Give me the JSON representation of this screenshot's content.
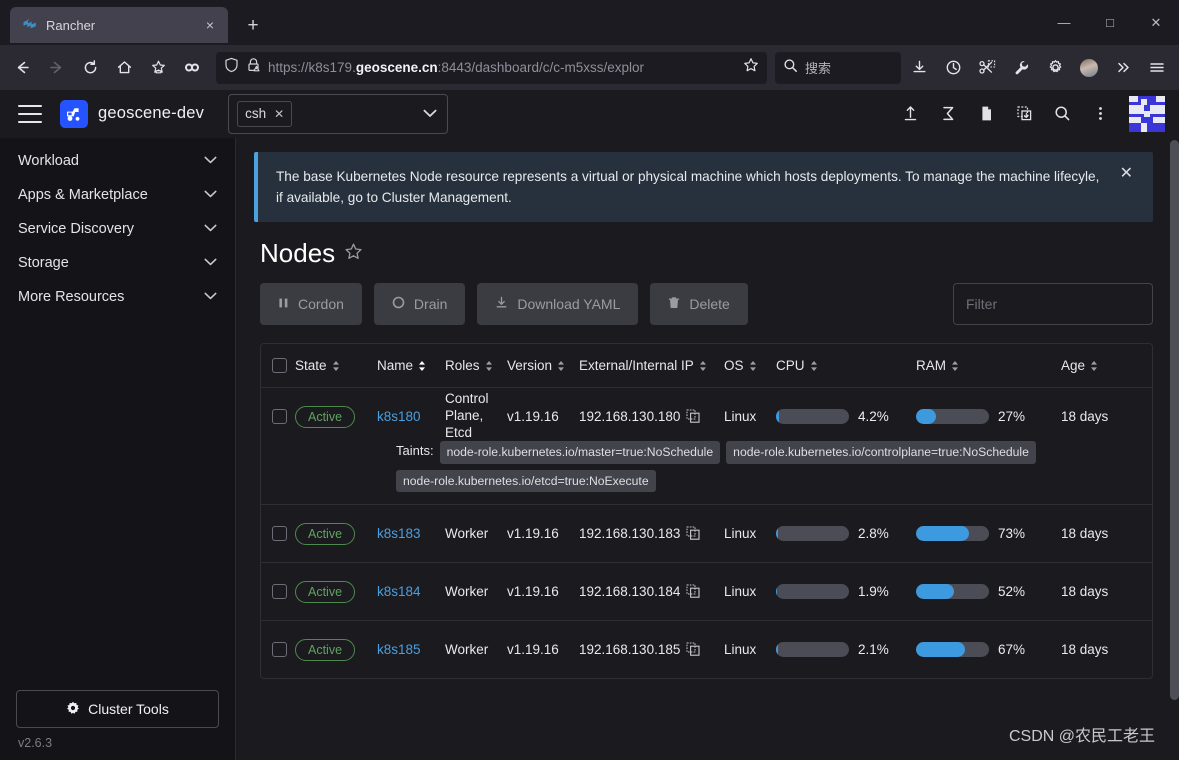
{
  "browser": {
    "tab": {
      "title": "Rancher",
      "favicon": "rancher-favicon",
      "close": "×"
    },
    "newtab_label": "+",
    "window_controls": {
      "minimize": "—",
      "maximize": "□",
      "close": "✕"
    },
    "nav": {
      "back": "←",
      "forward": "→",
      "reload": "↻",
      "home": "⌂",
      "bookmarks": "☆",
      "pocket": "∞"
    },
    "url": {
      "scheme": "https://",
      "host_pre": "k8s179.",
      "host_bold": "geoscene.cn",
      "rest": ":8443/dashboard/c/c-m5xss/explor",
      "full": "https://k8s179.geoscene.cn:8443/dashboard/c/c-m5xss/explor"
    },
    "url_bookmark": "☆",
    "search": {
      "placeholder": "搜索",
      "icon": "search-icon"
    },
    "toolbar_icons": [
      "download-icon",
      "history-icon",
      "screenshot-icon",
      "wrench-icon",
      "settings-gear-icon",
      "profile-avatar-icon",
      "overflow-chevrons-icon",
      "app-menu-icon"
    ]
  },
  "header": {
    "menu_icon": "hamburger-icon",
    "brand": "geoscene-dev",
    "namespace_select": {
      "chip": "csh",
      "chip_close": "✕",
      "caret": "⌄"
    },
    "actions": [
      "import-yaml-icon",
      "kubectl-shell-icon",
      "docs-icon",
      "download-kubeconfig-icon",
      "search-icon",
      "kebab-icon"
    ]
  },
  "sidebar": {
    "items": [
      {
        "label": "Workload"
      },
      {
        "label": "Apps & Marketplace"
      },
      {
        "label": "Service Discovery"
      },
      {
        "label": "Storage"
      },
      {
        "label": "More Resources"
      }
    ],
    "cluster_tools": "Cluster Tools",
    "version": "v2.6.3"
  },
  "banner": {
    "text": "The base Kubernetes Node resource represents a virtual or physical machine which hosts deployments. To manage the machine lifecyle, if available, go to Cluster Management.",
    "close": "✕"
  },
  "page": {
    "title": "Nodes",
    "favorite_icon": "☆"
  },
  "toolbar": {
    "cordon": "Cordon",
    "drain": "Drain",
    "download_yaml": "Download YAML",
    "delete": "Delete",
    "filter_placeholder": "Filter"
  },
  "table": {
    "columns": [
      "State",
      "Name",
      "Roles",
      "Version",
      "External/Internal IP",
      "OS",
      "CPU",
      "RAM",
      "Age"
    ],
    "rows": [
      {
        "state": "Active",
        "name": "k8s180",
        "roles": "Control Plane, Etcd",
        "version": "v1.19.16",
        "ip": "192.168.130.180",
        "os": "Linux",
        "cpu_pct": "4.2%",
        "cpu_value": 4.2,
        "ram_pct": "27%",
        "ram_value": 27,
        "age": "18 days",
        "taints_label": "Taints:",
        "taints": [
          "node-role.kubernetes.io/master=true:NoSchedule",
          "node-role.kubernetes.io/controlplane=true:NoSchedule",
          "node-role.kubernetes.io/etcd=true:NoExecute"
        ]
      },
      {
        "state": "Active",
        "name": "k8s183",
        "roles": "Worker",
        "version": "v1.19.16",
        "ip": "192.168.130.183",
        "os": "Linux",
        "cpu_pct": "2.8%",
        "cpu_value": 2.8,
        "ram_pct": "73%",
        "ram_value": 73,
        "age": "18 days",
        "taints": []
      },
      {
        "state": "Active",
        "name": "k8s184",
        "roles": "Worker",
        "version": "v1.19.16",
        "ip": "192.168.130.184",
        "os": "Linux",
        "cpu_pct": "1.9%",
        "cpu_value": 1.9,
        "ram_pct": "52%",
        "ram_value": 52,
        "age": "18 days",
        "taints": []
      },
      {
        "state": "Active",
        "name": "k8s185",
        "roles": "Worker",
        "version": "v1.19.16",
        "ip": "192.168.130.185",
        "os": "Linux",
        "cpu_pct": "2.1%",
        "cpu_value": 2.1,
        "ram_pct": "67%",
        "ram_value": 67,
        "age": "18 days",
        "taints": []
      }
    ]
  },
  "watermark": "CSDN @农民工老王",
  "colors": {
    "accent_blue": "#3d9ade",
    "link_blue": "#4b9ee0",
    "active_green": "#5fa35f",
    "banner_bg": "#27313d",
    "banner_accent": "#4aa3df",
    "brand_blue": "#2453ff"
  }
}
